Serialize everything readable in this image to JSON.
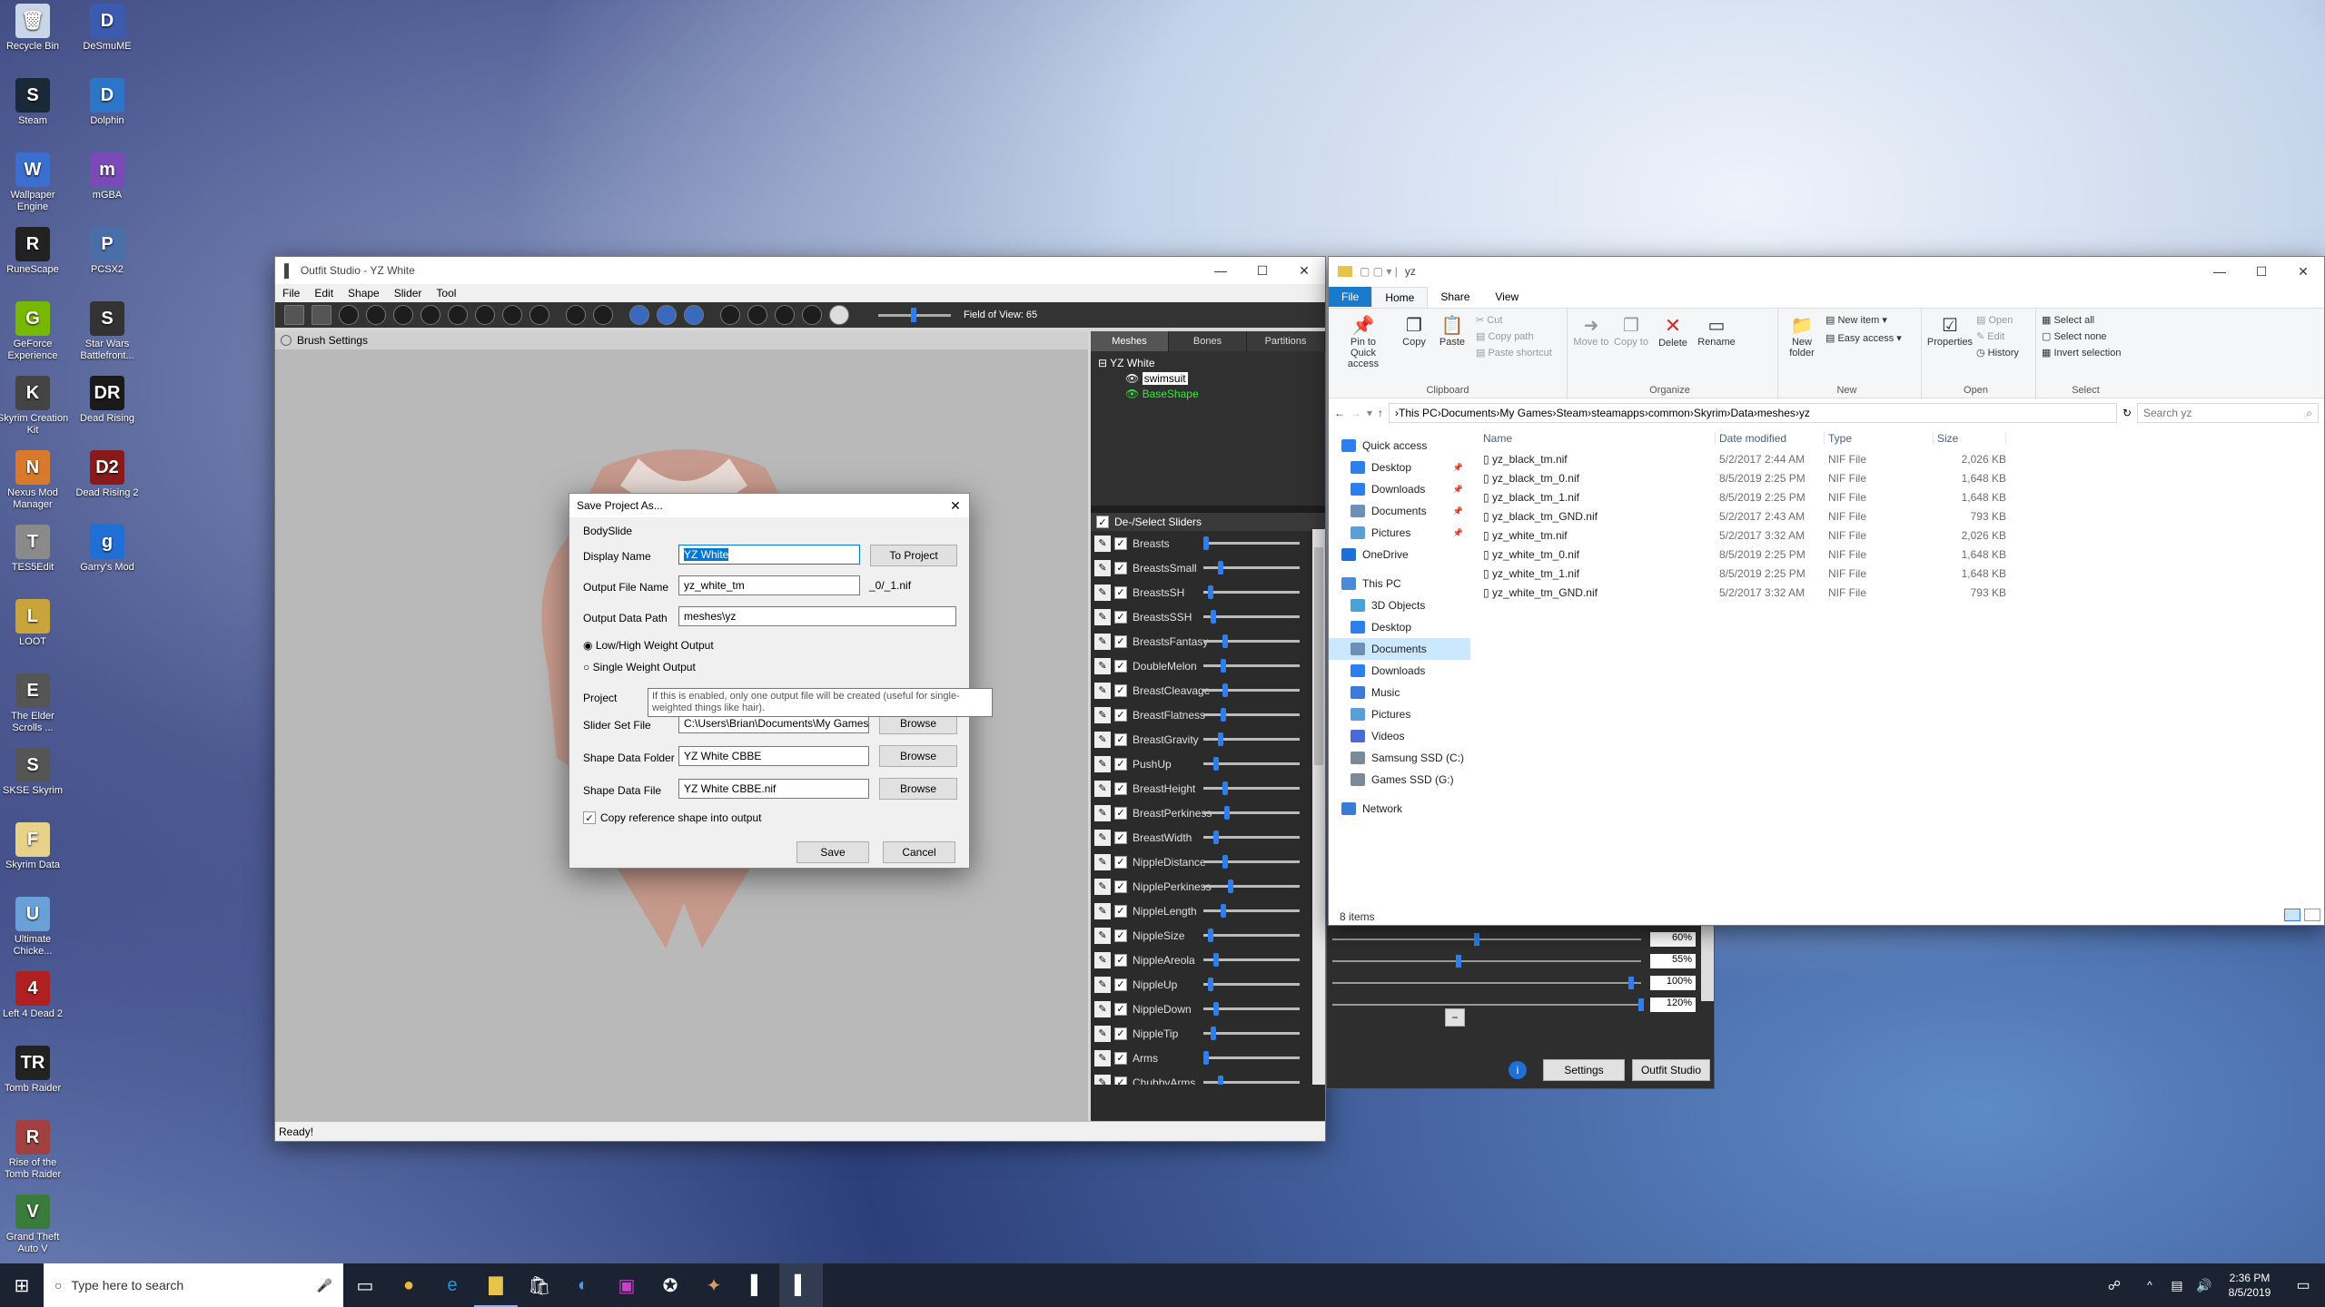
{
  "desktop": {
    "icons": [
      {
        "label": "Recycle Bin",
        "color": "#c8d6e5",
        "glyph": "🗑"
      },
      {
        "label": "DeSmuME",
        "color": "#3b5bb0",
        "glyph": "D"
      },
      {
        "label": "Steam",
        "color": "#1b2838",
        "glyph": "S"
      },
      {
        "label": "Dolphin",
        "color": "#2d76c7",
        "glyph": "D"
      },
      {
        "label": "Wallpaper Engine",
        "color": "#3a6fcf",
        "glyph": "W"
      },
      {
        "label": "mGBA",
        "color": "#7a4ab8",
        "glyph": "m"
      },
      {
        "label": "RuneScape",
        "color": "#222",
        "glyph": "R"
      },
      {
        "label": "PCSX2",
        "color": "#4a6fa8",
        "glyph": "P"
      },
      {
        "label": "GeForce Experience",
        "color": "#76b900",
        "glyph": "G"
      },
      {
        "label": "Star Wars Battlefront...",
        "color": "#333",
        "glyph": "S"
      },
      {
        "label": "Skyrim Creation Kit",
        "color": "#444",
        "glyph": "K"
      },
      {
        "label": "Dead Rising",
        "color": "#1a1a1a",
        "glyph": "DR"
      },
      {
        "label": "Nexus Mod Manager",
        "color": "#d87a2b",
        "glyph": "N"
      },
      {
        "label": "Dead Rising 2",
        "color": "#8a1a1a",
        "glyph": "D2"
      },
      {
        "label": "TES5Edit",
        "color": "#8a8a8a",
        "glyph": "T"
      },
      {
        "label": "Garry's Mod",
        "color": "#1f6fd6",
        "glyph": "g"
      },
      {
        "label": "LOOT",
        "color": "#c9a43a",
        "glyph": "L"
      },
      {
        "label": "The Elder Scrolls ...",
        "color": "#555",
        "glyph": "E"
      },
      {
        "label": "SKSE Skyrim",
        "color": "#555",
        "glyph": "S"
      },
      {
        "label": "Skyrim Data",
        "color": "#e8d28a",
        "glyph": "F"
      },
      {
        "label": "Ultimate Chicke...",
        "color": "#6aa0d8",
        "glyph": "U"
      },
      {
        "label": "Left 4 Dead 2",
        "color": "#b02020",
        "glyph": "4"
      },
      {
        "label": "Tomb Raider",
        "color": "#222",
        "glyph": "TR"
      },
      {
        "label": "Rise of the Tomb Raider",
        "color": "#a04040",
        "glyph": "R"
      },
      {
        "label": "Grand Theft Auto V",
        "color": "#3a7a3a",
        "glyph": "V"
      }
    ]
  },
  "outfit_studio": {
    "title": "Outfit Studio - YZ White",
    "menu": [
      "File",
      "Edit",
      "Shape",
      "Slider",
      "Tool"
    ],
    "fov_label": "Field of View: 65",
    "brush_settings": "Brush Settings",
    "status": "Ready!",
    "tabs": [
      "Meshes",
      "Bones",
      "Partitions"
    ],
    "tree": {
      "root": "YZ White",
      "children": [
        "swimsuit",
        "BaseShape"
      ]
    },
    "sliders_header": "De-/Select Sliders",
    "sliders": [
      {
        "name": "Breasts",
        "pos": 0
      },
      {
        "name": "BreastsSmall",
        "pos": 0.15
      },
      {
        "name": "BreastsSH",
        "pos": 0.05
      },
      {
        "name": "BreastsSSH",
        "pos": 0.08
      },
      {
        "name": "BreastsFantasy",
        "pos": 0.2
      },
      {
        "name": "DoubleMelon",
        "pos": 0.18
      },
      {
        "name": "BreastCleavage",
        "pos": 0.2
      },
      {
        "name": "BreastFlatness",
        "pos": 0.18
      },
      {
        "name": "BreastGravity",
        "pos": 0.15
      },
      {
        "name": "PushUp",
        "pos": 0.1
      },
      {
        "name": "BreastHeight",
        "pos": 0.2
      },
      {
        "name": "BreastPerkiness",
        "pos": 0.22
      },
      {
        "name": "BreastWidth",
        "pos": 0.1
      },
      {
        "name": "NippleDistance",
        "pos": 0.2
      },
      {
        "name": "NipplePerkiness",
        "pos": 0.25
      },
      {
        "name": "NippleLength",
        "pos": 0.18
      },
      {
        "name": "NippleSize",
        "pos": 0.05
      },
      {
        "name": "NippleAreola",
        "pos": 0.1
      },
      {
        "name": "NippleUp",
        "pos": 0.05
      },
      {
        "name": "NippleDown",
        "pos": 0.1
      },
      {
        "name": "NippleTip",
        "pos": 0.08
      },
      {
        "name": "Arms",
        "pos": 0
      },
      {
        "name": "ChubbyArms",
        "pos": 0.15
      }
    ]
  },
  "save_dialog": {
    "title": "Save Project As...",
    "section_bodyslide": "BodySlide",
    "display_name_label": "Display Name",
    "display_name": "YZ White",
    "to_project": "To Project",
    "output_file_label": "Output File Name",
    "output_file": "yz_white_tm",
    "output_suffix": "_0/_1.nif",
    "output_path_label": "Output Data Path",
    "output_path": "meshes\\yz",
    "radio_low_high": "Low/High Weight Output",
    "radio_single": "Single Weight Output",
    "tooltip": "If this is enabled, only one output file will be created (useful for single-weighted things like hair).",
    "section_project": "Project",
    "slider_set_label": "Slider Set File",
    "slider_set": "C:\\Users\\Brian\\Documents\\My Games",
    "shape_folder_label": "Shape Data Folder",
    "shape_folder": "YZ White CBBE",
    "shape_file_label": "Shape Data File",
    "shape_file": "YZ White CBBE.nif",
    "browse": "Browse",
    "copy_ref": "Copy reference shape into output",
    "save": "Save",
    "cancel": "Cancel"
  },
  "bodyslide": {
    "percents": [
      "60%",
      "55%",
      "100%",
      "120%"
    ],
    "minus": "−",
    "settings": "Settings",
    "outfit_studio": "Outfit Studio"
  },
  "explorer": {
    "title": "yz",
    "ribbon_tabs": [
      "File",
      "Home",
      "Share",
      "View"
    ],
    "clipboard": {
      "pin": "Pin to Quick access",
      "copy": "Copy",
      "paste": "Paste",
      "cut": "Cut",
      "copy_path": "Copy path",
      "paste_shortcut": "Paste shortcut",
      "label": "Clipboard"
    },
    "organize": {
      "move": "Move to",
      "copy": "Copy to",
      "delete": "Delete",
      "rename": "Rename",
      "label": "Organize"
    },
    "new": {
      "new_folder": "New folder",
      "new_item": "New item",
      "easy_access": "Easy access",
      "label": "New"
    },
    "open": {
      "properties": "Properties",
      "open": "Open",
      "edit": "Edit",
      "history": "History",
      "label": "Open"
    },
    "select": {
      "all": "Select all",
      "none": "Select none",
      "invert": "Invert selection",
      "label": "Select"
    },
    "breadcrumb": [
      "This PC",
      "Documents",
      "My Games",
      "Steam",
      "steamapps",
      "common",
      "Skyrim",
      "Data",
      "meshes",
      "yz"
    ],
    "search_placeholder": "Search yz",
    "nav": [
      {
        "label": "Quick access",
        "color": "#2d7ff0",
        "indent": 0,
        "pin": false
      },
      {
        "label": "Desktop",
        "color": "#2d7ff0",
        "indent": 1,
        "pin": true
      },
      {
        "label": "Downloads",
        "color": "#2d7ff0",
        "indent": 1,
        "pin": true
      },
      {
        "label": "Documents",
        "color": "#6d8fb8",
        "indent": 1,
        "pin": true
      },
      {
        "label": "Pictures",
        "color": "#5aa0d8",
        "indent": 1,
        "pin": true
      },
      {
        "label": "OneDrive",
        "color": "#1e6fd6",
        "indent": 0,
        "pin": false
      },
      {
        "label": "This PC",
        "color": "#4a8ad8",
        "indent": 0,
        "pin": false
      },
      {
        "label": "3D Objects",
        "color": "#4aa0d8",
        "indent": 1,
        "pin": false
      },
      {
        "label": "Desktop",
        "color": "#2d7ff0",
        "indent": 1,
        "pin": false
      },
      {
        "label": "Documents",
        "color": "#6d8fb8",
        "indent": 1,
        "pin": false
      },
      {
        "label": "Downloads",
        "color": "#2d7ff0",
        "indent": 1,
        "pin": false
      },
      {
        "label": "Music",
        "color": "#3a7ad8",
        "indent": 1,
        "pin": false
      },
      {
        "label": "Pictures",
        "color": "#5aa0d8",
        "indent": 1,
        "pin": false
      },
      {
        "label": "Videos",
        "color": "#4a6ad8",
        "indent": 1,
        "pin": false
      },
      {
        "label": "Samsung SSD (C:)",
        "color": "#7a8a9a",
        "indent": 1,
        "pin": false
      },
      {
        "label": "Games SSD (G:)",
        "color": "#7a8a9a",
        "indent": 1,
        "pin": false
      },
      {
        "label": "Network",
        "color": "#3a7ad8",
        "indent": 0,
        "pin": false
      }
    ],
    "columns": [
      "Name",
      "Date modified",
      "Type",
      "Size"
    ],
    "files": [
      {
        "name": "yz_black_tm.nif",
        "date": "5/2/2017 2:44 AM",
        "type": "NIF File",
        "size": "2,026 KB"
      },
      {
        "name": "yz_black_tm_0.nif",
        "date": "8/5/2019 2:25 PM",
        "type": "NIF File",
        "size": "1,648 KB"
      },
      {
        "name": "yz_black_tm_1.nif",
        "date": "8/5/2019 2:25 PM",
        "type": "NIF File",
        "size": "1,648 KB"
      },
      {
        "name": "yz_black_tm_GND.nif",
        "date": "5/2/2017 2:43 AM",
        "type": "NIF File",
        "size": "793 KB"
      },
      {
        "name": "yz_white_tm.nif",
        "date": "5/2/2017 3:32 AM",
        "type": "NIF File",
        "size": "2,026 KB"
      },
      {
        "name": "yz_white_tm_0.nif",
        "date": "8/5/2019 2:25 PM",
        "type": "NIF File",
        "size": "1,648 KB"
      },
      {
        "name": "yz_white_tm_1.nif",
        "date": "8/5/2019 2:25 PM",
        "type": "NIF File",
        "size": "1,648 KB"
      },
      {
        "name": "yz_white_tm_GND.nif",
        "date": "5/2/2017 3:32 AM",
        "type": "NIF File",
        "size": "793 KB"
      }
    ],
    "status": "8 items"
  },
  "taskbar": {
    "search_placeholder": "Type here to search",
    "time": "2:36 PM",
    "date": "8/5/2019"
  }
}
